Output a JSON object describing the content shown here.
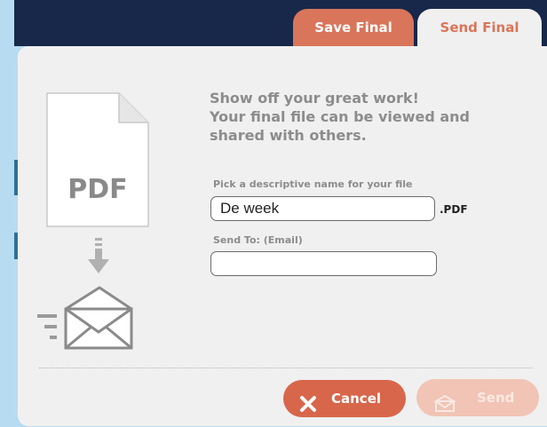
{
  "tabs": [
    {
      "label": "Save Final",
      "active": false
    },
    {
      "label": "Send Final",
      "active": true
    }
  ],
  "illustration": {
    "pdf_label": "PDF",
    "icons": [
      "pdf-document-icon",
      "arrow-down-icon",
      "envelope-icon"
    ]
  },
  "headline": {
    "line1": "Show off your great work!",
    "line2": "Your final file can be viewed and",
    "line3": "shared with others."
  },
  "form": {
    "name_label": "Pick a descriptive name for your file",
    "name_value": "De week",
    "name_suffix": ".PDF",
    "email_label": "Send To: (Email)",
    "email_value": ""
  },
  "buttons": {
    "cancel_label": "Cancel",
    "send_label": "Send"
  },
  "colors": {
    "accent": "#d9755a",
    "cancel": "#d8664b",
    "send_disabled": "#f1c4b5",
    "panel": "#f0f0f0",
    "topbar": "#17284a",
    "background": "#b7dcf2"
  }
}
